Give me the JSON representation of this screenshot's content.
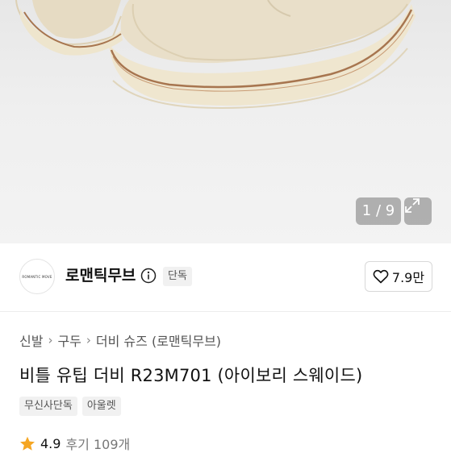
{
  "hero": {
    "counter": "1 / 9",
    "expand_icon": "expand-icon"
  },
  "brand": {
    "logo_text": "ROMANTIC MOVE",
    "name": "로맨틱무브",
    "info_icon": "info-icon",
    "badge": "단독"
  },
  "like": {
    "icon": "heart-icon",
    "count": "7.9만"
  },
  "breadcrumb": [
    "신발",
    "구두",
    "더비 슈즈 (로맨틱무브)"
  ],
  "product": {
    "title": "비틀 유팁 더비 R23M701 (아이보리 스웨이드)"
  },
  "tags": [
    "무신사단독",
    "아울렛"
  ],
  "rating": {
    "icon": "star-icon",
    "score": "4.9",
    "reviews": "후기 109개"
  },
  "colors": {
    "star": "#f5a623",
    "shoe_suede": "#e9dfc9",
    "sole": "#efe6cf",
    "welt": "#a7754f"
  }
}
